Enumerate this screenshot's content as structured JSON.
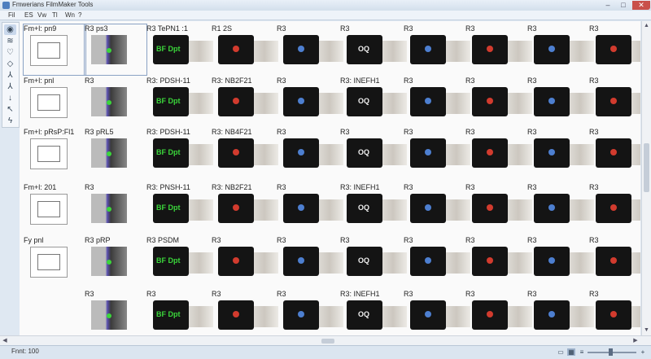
{
  "window": {
    "title": "Fmwerians FilmMaker Tools",
    "buttons": {
      "minimize": "‒",
      "maximize": "□",
      "close": "✕"
    }
  },
  "menu": [
    "Fil",
    "ES",
    "Vw",
    "Tl",
    "Wn",
    "?"
  ],
  "toolbar": {
    "tools": [
      {
        "icon": "eye-icon",
        "glyph": "◉"
      },
      {
        "icon": "layers-icon",
        "glyph": "≋"
      },
      {
        "icon": "shield-icon",
        "glyph": "♡"
      },
      {
        "icon": "adjust-icon",
        "glyph": "◇"
      },
      {
        "icon": "branch-icon",
        "glyph": "⅄"
      },
      {
        "icon": "split-icon",
        "glyph": "⅄"
      },
      {
        "icon": "arrow-down-icon",
        "glyph": "↓"
      },
      {
        "icon": "cursor-icon",
        "glyph": "↖"
      },
      {
        "icon": "bolt-icon",
        "glyph": "ϟ"
      }
    ]
  },
  "grid": {
    "rows": [
      {
        "cells": [
          {
            "label": "Fm+l: pn9",
            "type": "doc"
          },
          {
            "label": "R3 ps3",
            "type": "pipe"
          },
          {
            "label": "R3 TePN1 :1",
            "type": "dark"
          },
          {
            "label": "R1 2S",
            "type": "dark"
          },
          {
            "label": "R3",
            "type": "dark"
          },
          {
            "label": "R3",
            "type": "dark"
          },
          {
            "label": "R3",
            "type": "dark"
          },
          {
            "label": "R3",
            "type": "dark"
          },
          {
            "label": "R3",
            "type": "dark"
          },
          {
            "label": "R3",
            "type": "dark"
          }
        ]
      },
      {
        "cells": [
          {
            "label": "Fm+l: pnl",
            "type": "doc"
          },
          {
            "label": "R3",
            "type": "pipe"
          },
          {
            "label": "R3: PDSH-11",
            "type": "dark"
          },
          {
            "label": "R3: NB2F21",
            "type": "dark"
          },
          {
            "label": "R3",
            "type": "dark"
          },
          {
            "label": "R3: INEFH1",
            "type": "dark"
          },
          {
            "label": "R3",
            "type": "dark"
          },
          {
            "label": "R3",
            "type": "dark"
          },
          {
            "label": "R3",
            "type": "dark"
          },
          {
            "label": "R3",
            "type": "dark"
          }
        ]
      },
      {
        "cells": [
          {
            "label": "Fm+l: pRsP:Fl1",
            "type": "doc"
          },
          {
            "label": "R3 pRL5",
            "type": "pipe"
          },
          {
            "label": "R3: PDSH-11",
            "type": "dark"
          },
          {
            "label": "R3: NB4F21",
            "type": "dark"
          },
          {
            "label": "R3",
            "type": "dark"
          },
          {
            "label": "R3",
            "type": "dark"
          },
          {
            "label": "R3",
            "type": "dark"
          },
          {
            "label": "R3",
            "type": "dark"
          },
          {
            "label": "R3",
            "type": "dark"
          },
          {
            "label": "R3",
            "type": "dark"
          }
        ]
      },
      {
        "cells": [
          {
            "label": "Fm+l: 201",
            "type": "doc"
          },
          {
            "label": "R3",
            "type": "pipe"
          },
          {
            "label": "R3: PNSH-11",
            "type": "dark"
          },
          {
            "label": "R3: NB2F21",
            "type": "dark"
          },
          {
            "label": "R3",
            "type": "dark"
          },
          {
            "label": "R3: INEFH1",
            "type": "dark"
          },
          {
            "label": "R3",
            "type": "dark"
          },
          {
            "label": "R3",
            "type": "dark"
          },
          {
            "label": "R3",
            "type": "dark"
          },
          {
            "label": "R3",
            "type": "dark"
          }
        ]
      },
      {
        "cells": [
          {
            "label": "Fy pnl",
            "type": "doc"
          },
          {
            "label": "R3 pRP",
            "type": "pipe"
          },
          {
            "label": "R3 PSDM",
            "type": "dark"
          },
          {
            "label": "R3",
            "type": "dark"
          },
          {
            "label": "R3",
            "type": "dark"
          },
          {
            "label": "R3",
            "type": "dark"
          },
          {
            "label": "R3",
            "type": "dark"
          },
          {
            "label": "R3",
            "type": "dark"
          },
          {
            "label": "R3",
            "type": "dark"
          },
          {
            "label": "R3",
            "type": "dark"
          }
        ]
      },
      {
        "cells": [
          {
            "label": "",
            "type": "empty"
          },
          {
            "label": "R3",
            "type": "pipe"
          },
          {
            "label": "R3",
            "type": "dark"
          },
          {
            "label": "R3",
            "type": "dark"
          },
          {
            "label": "R3",
            "type": "dark"
          },
          {
            "label": "R3: INEFH1",
            "type": "dark"
          },
          {
            "label": "R3",
            "type": "dark"
          },
          {
            "label": "R3",
            "type": "dark"
          },
          {
            "label": "R3",
            "type": "dark"
          },
          {
            "label": "R3",
            "type": "dark"
          }
        ]
      }
    ],
    "badge_text": "BF Dpt",
    "q_text": "OQ",
    "colors": {
      "green": "#3bd63b",
      "red": "#d23b2e",
      "blue": "#4d7fd0"
    }
  },
  "statusbar": {
    "text": "Fnnt: 100",
    "icons": [
      "page-icon",
      "grid-icon",
      "list-icon",
      "zoom-out-icon",
      "zoom-in-icon"
    ]
  }
}
